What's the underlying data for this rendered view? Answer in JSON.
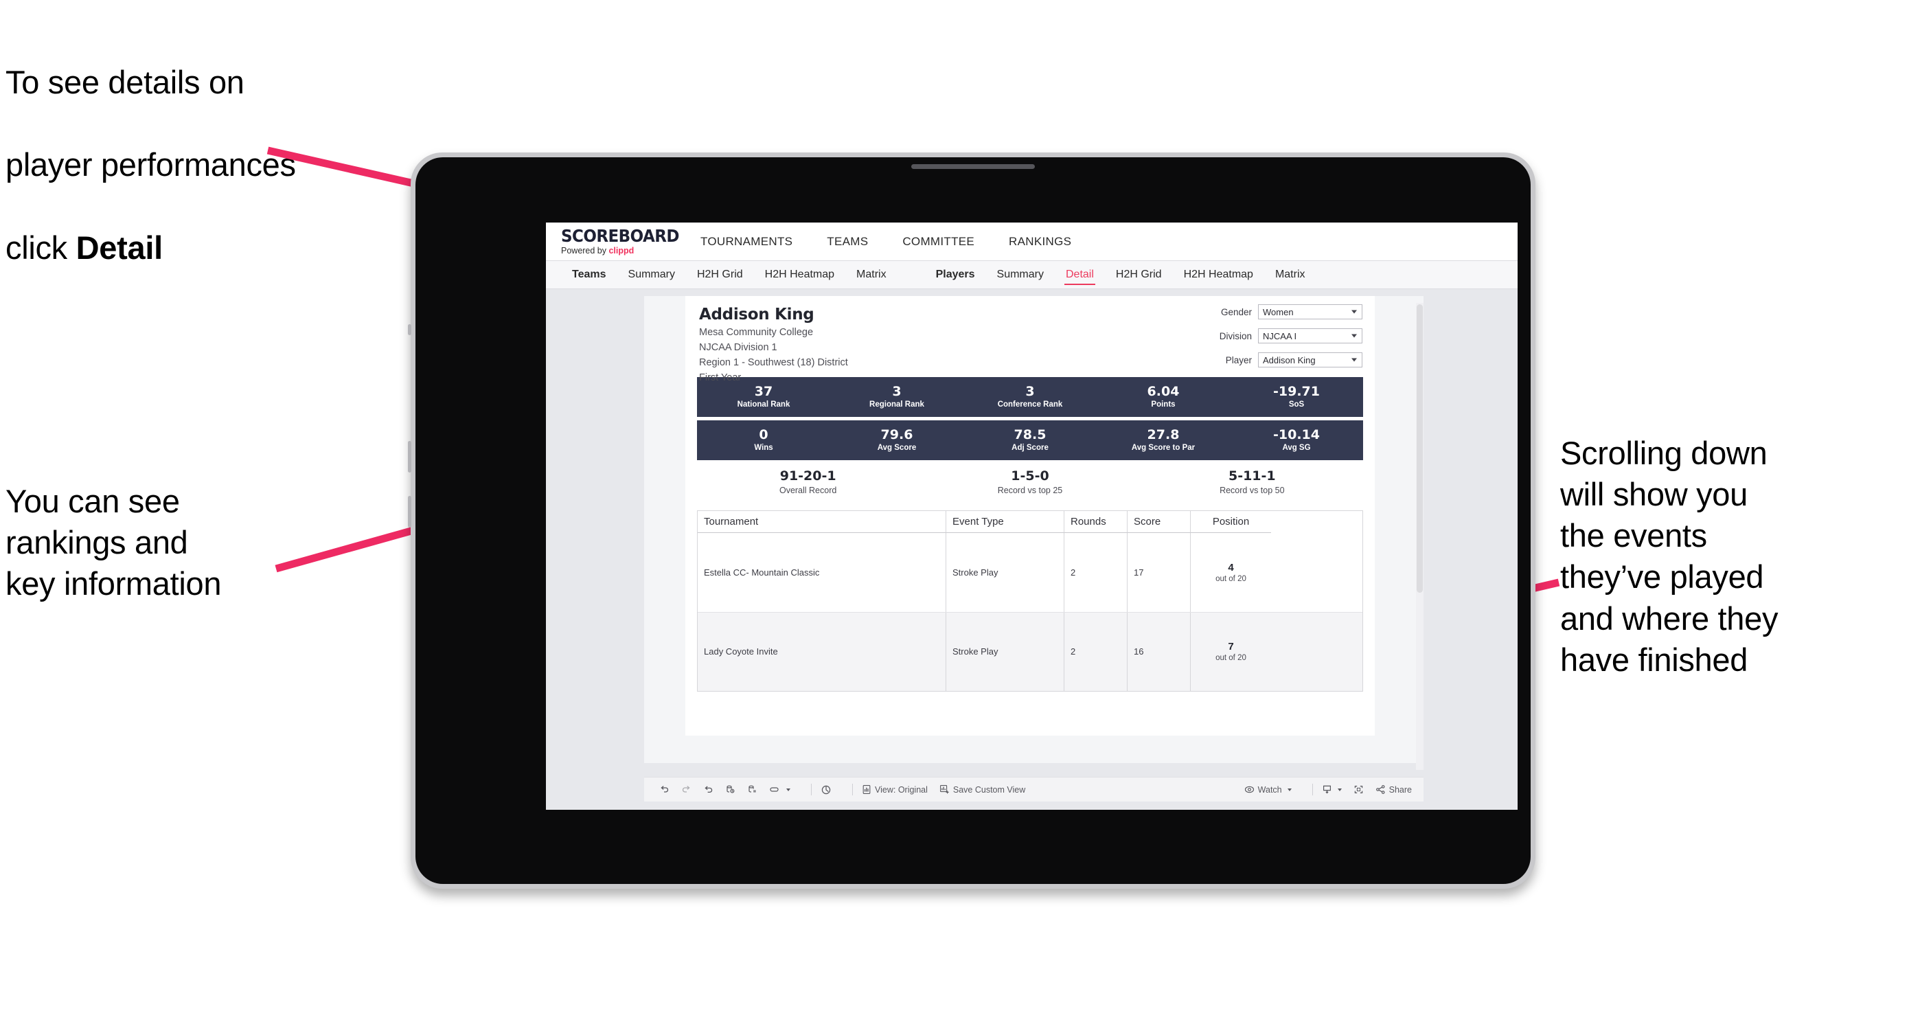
{
  "annotations": {
    "top_left": {
      "line1": "To see details on",
      "line2": "player performances",
      "line3_prefix": "click ",
      "line3_bold": "Detail"
    },
    "bottom_left": {
      "text": "You can see\nrankings and\nkey information"
    },
    "right": {
      "text": "Scrolling down\nwill show you\nthe events\nthey’ve played\nand where they\nhave finished"
    }
  },
  "accent_color": "#ec3b5e",
  "arrow_color": "#ee2a63",
  "panel_color": "#343a52",
  "app": {
    "brand": {
      "name": "SCOREBOARD",
      "powered_prefix": "Powered by ",
      "powered_brand": "clippd"
    },
    "top_nav": [
      {
        "label": "TOURNAMENTS"
      },
      {
        "label": "TEAMS"
      },
      {
        "label": "COMMITTEE"
      },
      {
        "label": "RANKINGS"
      }
    ],
    "sub_nav": {
      "teams_group": [
        {
          "label": "Teams",
          "strong": true
        },
        {
          "label": "Summary"
        },
        {
          "label": "H2H Grid"
        },
        {
          "label": "H2H Heatmap"
        },
        {
          "label": "Matrix"
        }
      ],
      "players_group": [
        {
          "label": "Players",
          "strong": true
        },
        {
          "label": "Summary"
        },
        {
          "label": "Detail",
          "active": true
        },
        {
          "label": "H2H Grid"
        },
        {
          "label": "H2H Heatmap"
        },
        {
          "label": "Matrix"
        }
      ]
    },
    "player": {
      "name": "Addison King",
      "school": "Mesa Community College",
      "division": "NJCAA Division 1",
      "region": "Region 1 - Southwest (18) District",
      "year": "First Year"
    },
    "filters": [
      {
        "label": "Gender",
        "value": "Women"
      },
      {
        "label": "Division",
        "value": "NJCAA I"
      },
      {
        "label": "Player",
        "value": "Addison King"
      }
    ],
    "stats_row_1": [
      {
        "value": "37",
        "label": "National Rank"
      },
      {
        "value": "3",
        "label": "Regional Rank"
      },
      {
        "value": "3",
        "label": "Conference Rank"
      },
      {
        "value": "6.04",
        "label": "Points"
      },
      {
        "value": "-19.71",
        "label": "SoS"
      }
    ],
    "stats_row_2": [
      {
        "value": "0",
        "label": "Wins"
      },
      {
        "value": "79.6",
        "label": "Avg Score"
      },
      {
        "value": "78.5",
        "label": "Adj Score"
      },
      {
        "value": "27.8",
        "label": "Avg Score to Par"
      },
      {
        "value": "-10.14",
        "label": "Avg SG"
      }
    ],
    "records": [
      {
        "value": "91-20-1",
        "label": "Overall Record"
      },
      {
        "value": "1-5-0",
        "label": "Record vs top 25"
      },
      {
        "value": "5-11-1",
        "label": "Record vs top 50"
      }
    ],
    "results_table": {
      "columns": [
        "Tournament",
        "Event Type",
        "Rounds",
        "Score",
        "Position"
      ],
      "rows": [
        {
          "tournament": "Estella CC- Mountain Classic",
          "event_type": "Stroke Play",
          "rounds": "2",
          "score": "17",
          "position_num": "4",
          "position_of": "out of 20"
        },
        {
          "tournament": "Lady Coyote Invite",
          "event_type": "Stroke Play",
          "rounds": "2",
          "score": "16",
          "position_num": "7",
          "position_of": "out of 20"
        }
      ]
    },
    "toolbar": {
      "view_label": "View: Original",
      "save_label": "Save Custom View",
      "watch_label": "Watch",
      "share_label": "Share"
    }
  }
}
